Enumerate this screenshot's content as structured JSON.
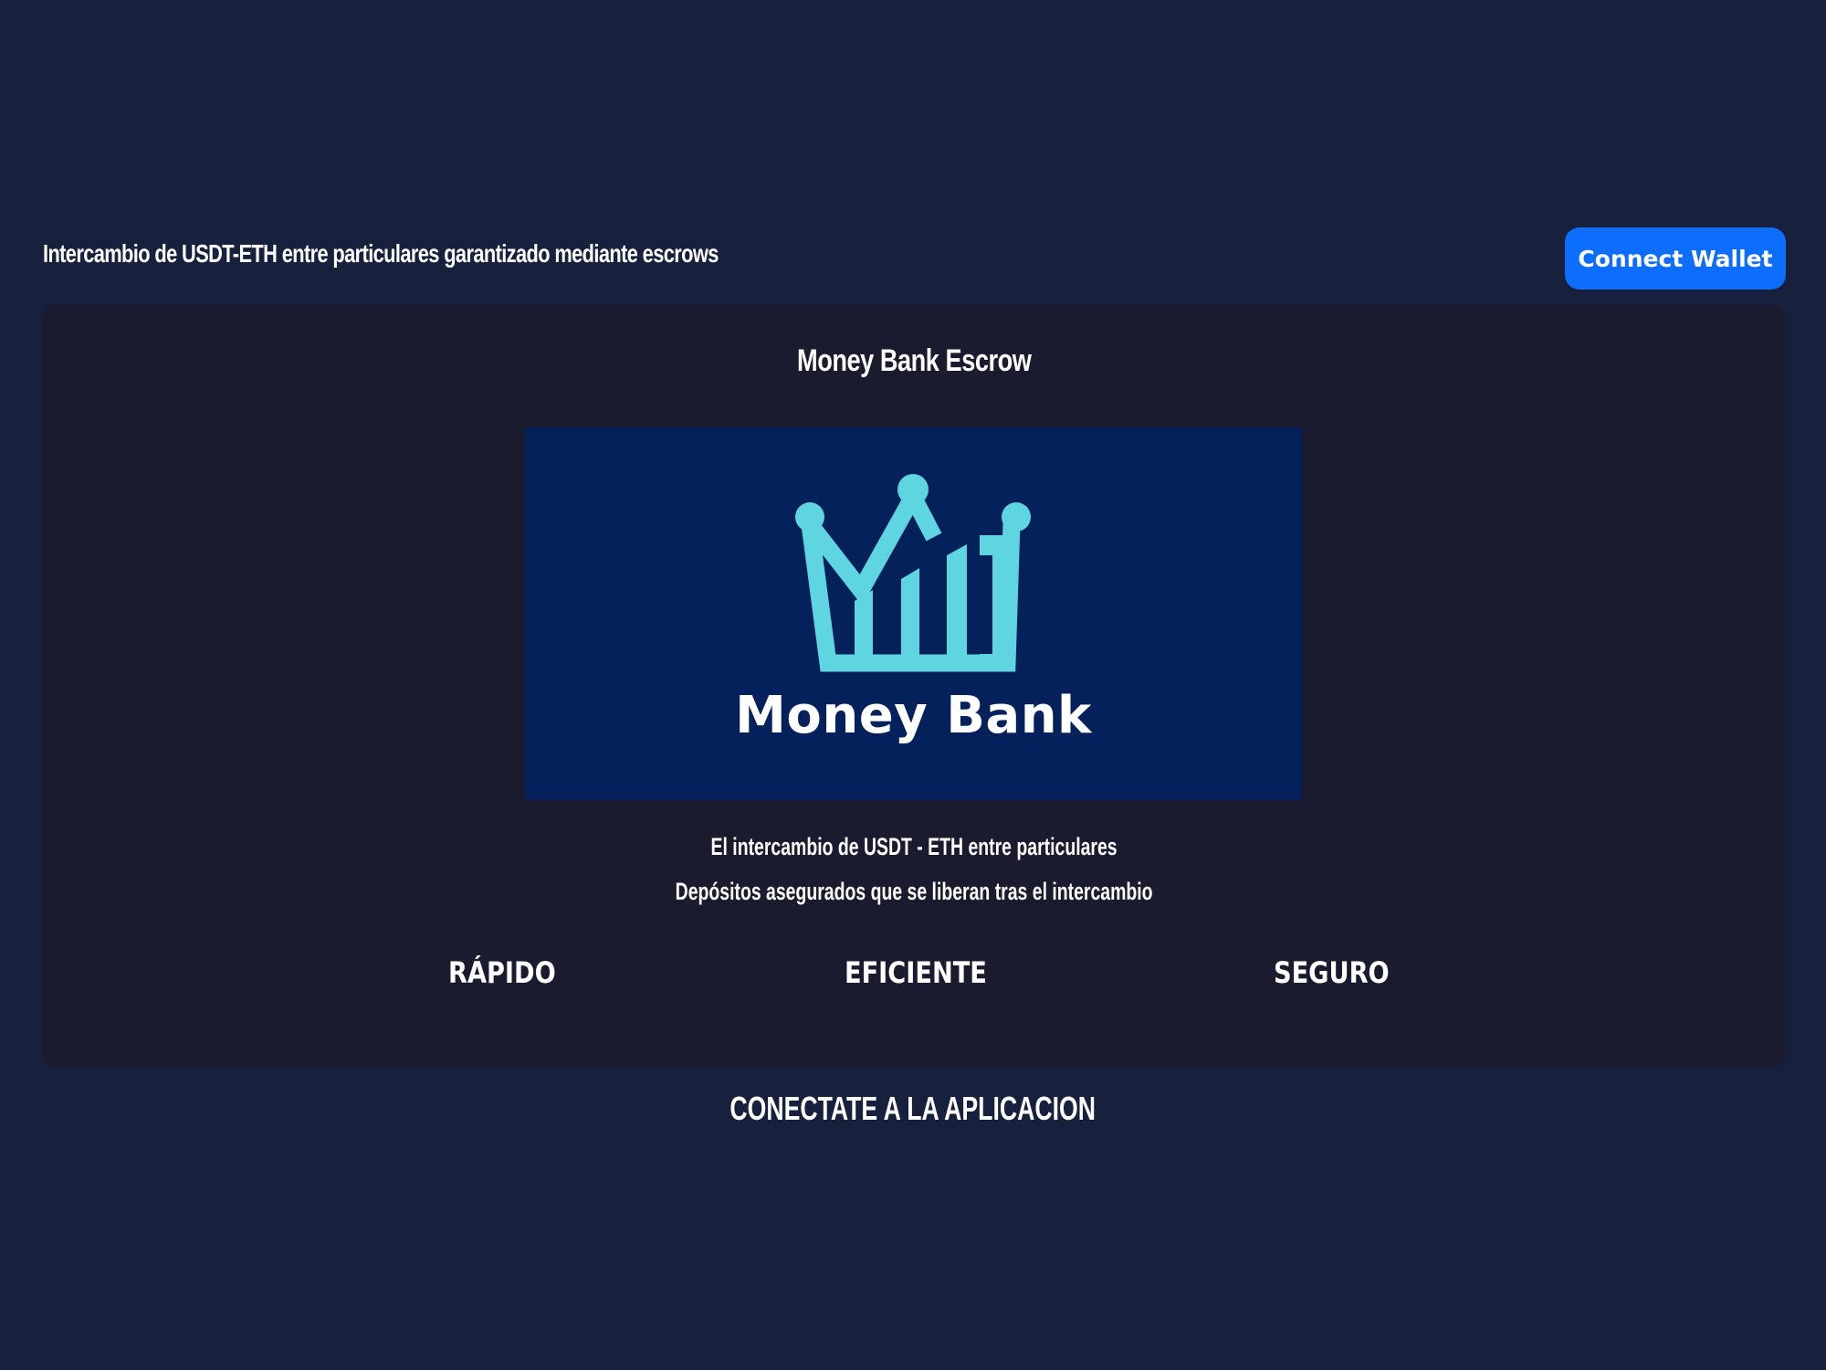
{
  "header": {
    "tagline": "Intercambio de USDT-ETH entre particulares garantizado mediante escrows",
    "connect_button": "Connect Wallet"
  },
  "card": {
    "title": "Money Bank Escrow",
    "logo_text": "Money Bank",
    "description_line1": "El intercambio de USDT - ETH entre particulares",
    "description_line2": "Depósitos asegurados que se liberan tras el intercambio",
    "features": [
      "RÁPIDO",
      "EFICIENTE",
      "SEGURO"
    ]
  },
  "footer": {
    "connect_hint": "CONECTATE A LA APLICACION"
  },
  "colors": {
    "background": "#17213e",
    "card": "#1a1b2e",
    "logo_background": "#05215c",
    "logo_accent": "#5ed5e0",
    "button": "#0d6efd"
  }
}
